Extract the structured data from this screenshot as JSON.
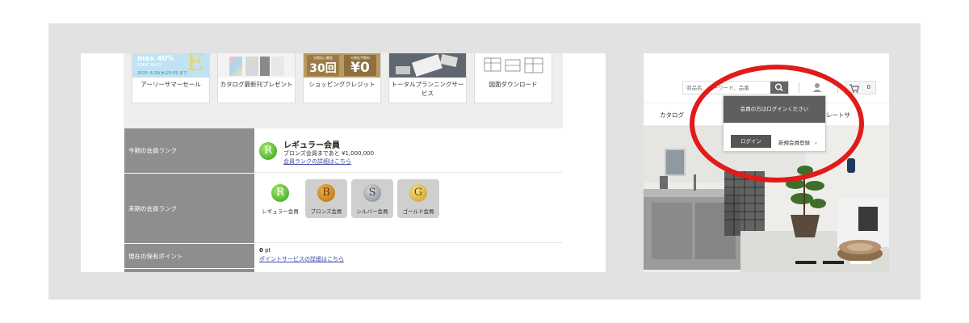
{
  "promo": {
    "cards": [
      {
        "label": "アーリーサマーセール",
        "icon": "summer-sale-banner"
      },
      {
        "label": "カタログ最新刊プレゼント",
        "icon": "catalog-books-image"
      },
      {
        "label": "ショッピングクレジット",
        "icon": "shopping-credit-banner"
      },
      {
        "label": "トータルプランニングサービス",
        "icon": "planning-photo"
      },
      {
        "label": "図面ダウンロード",
        "icon": "drawing-image"
      }
    ],
    "summer": {
      "pct": "max 40%",
      "pb": "POINT BACK",
      "big": "E",
      "date": "2020. 8.26(水)23:59 まで"
    },
    "credit": {
      "left_small": "分割払い最長",
      "left_big": "30回",
      "left_suffix": "まで",
      "right_small": "分割払手数料",
      "right_big": "¥0"
    }
  },
  "rank": {
    "current_label": "今期の会員ランク",
    "current_badge": "R",
    "current_name": "レギュラー会員",
    "current_sub": "ブロンズ会員まであと ¥1,000,000",
    "current_link": "会員ランクの詳細はこちら",
    "next_label": "来期の会員ランク",
    "tiers": [
      {
        "letter": "R",
        "name": "レギュラー会員"
      },
      {
        "letter": "B",
        "name": "ブロンズ会員"
      },
      {
        "letter": "S",
        "name": "シルバー会員"
      },
      {
        "letter": "G",
        "name": "ゴールド会員"
      }
    ],
    "points_label": "現在の保有ポイント",
    "points_value": "0",
    "points_unit": "pt",
    "points_link": "ポイントサービスの詳細はこちら"
  },
  "header": {
    "search_placeholder": "商品名、キーワード、品番",
    "cart_count": "0",
    "nav_catalog": "カタログ",
    "nav_right": "レートサ"
  },
  "login": {
    "message": "会員の方はログインください",
    "login_button": "ログイン",
    "register_link": "新規会員登録",
    "register_arrow": "›"
  },
  "colors": {
    "stage": "#e2e2e2",
    "accent_red": "#e11a1a",
    "label_gray": "#8e8e8e"
  }
}
